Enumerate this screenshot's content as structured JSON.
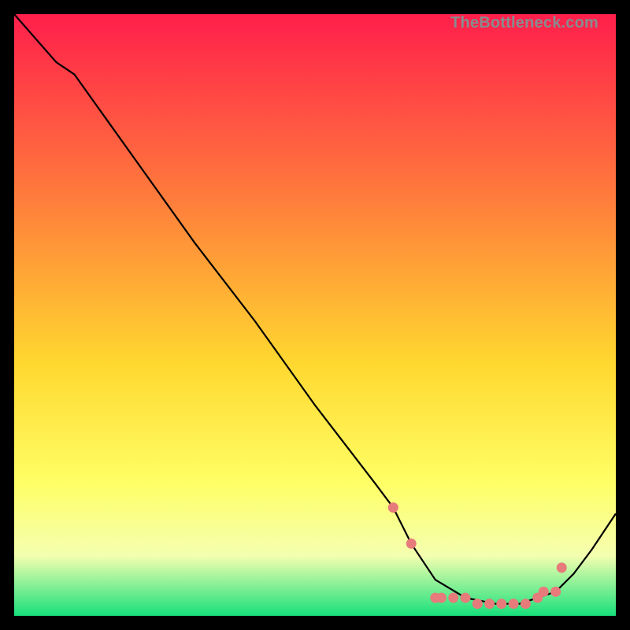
{
  "watermark": "TheBottleneck.com",
  "colors": {
    "gradient_top": "#ff1f4b",
    "gradient_mid1": "#ff7a3c",
    "gradient_mid2": "#ffd82f",
    "gradient_mid3": "#ffff66",
    "gradient_mid4": "#f4ffb0",
    "gradient_bottom": "#17e07b",
    "curve": "#000000",
    "dot": "#e77a7a"
  },
  "chart_data": {
    "type": "line",
    "title": "",
    "xlabel": "",
    "ylabel": "",
    "xlim": [
      0,
      100
    ],
    "ylim": [
      0,
      100
    ],
    "series": [
      {
        "name": "bottleneck-curve",
        "x": [
          0,
          7,
          10,
          20,
          30,
          40,
          50,
          60,
          63,
          66,
          70,
          75,
          80,
          84,
          87,
          90,
          93,
          96,
          100
        ],
        "y": [
          100,
          92,
          90,
          76,
          62,
          49,
          35,
          22,
          18,
          12,
          6,
          3,
          2,
          2,
          3,
          4,
          7,
          11,
          17
        ]
      }
    ],
    "dots": {
      "name": "highlight-dots",
      "x": [
        63,
        66,
        70,
        71,
        73,
        75,
        77,
        79,
        81,
        83,
        85,
        87,
        88,
        90,
        91
      ],
      "y": [
        18,
        12,
        3,
        3,
        3,
        3,
        2,
        2,
        2,
        2,
        2,
        3,
        4,
        4,
        8
      ]
    }
  }
}
